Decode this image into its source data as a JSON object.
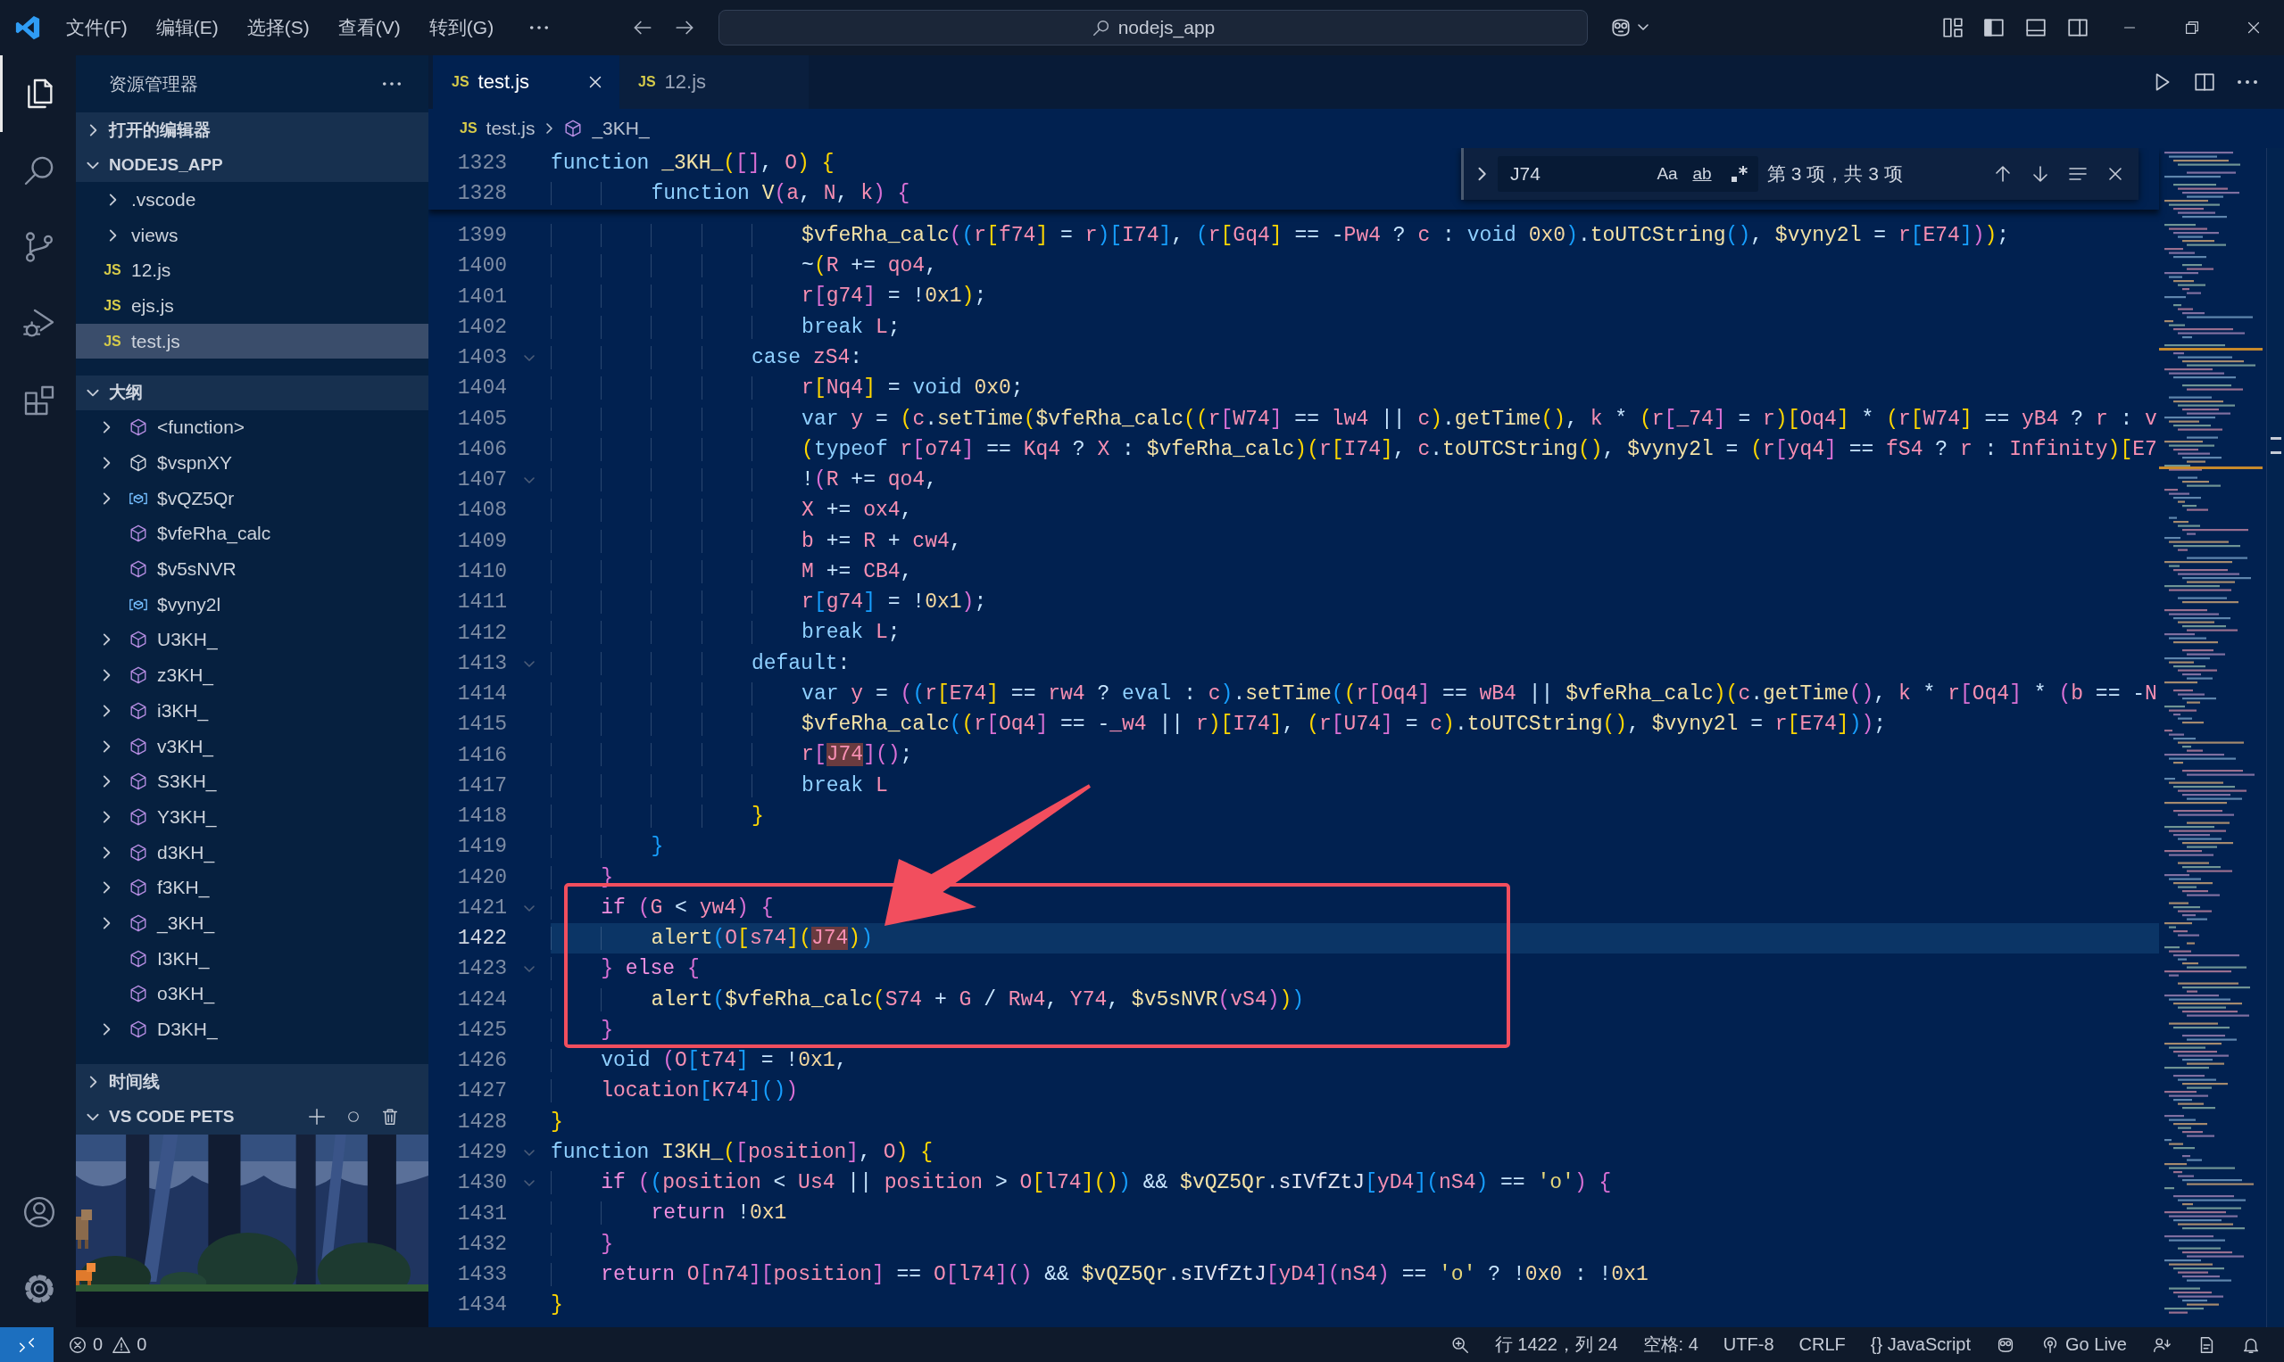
{
  "title_bar": {
    "menus": [
      "文件(F)",
      "编辑(E)",
      "选择(S)",
      "查看(V)",
      "转到(G)"
    ],
    "search": "nodejs_app"
  },
  "activity_bar": {
    "items": [
      {
        "kind": "files",
        "selected": true
      },
      {
        "kind": "search",
        "selected": false
      },
      {
        "kind": "source_control",
        "selected": false
      },
      {
        "kind": "run_debug",
        "selected": false
      },
      {
        "kind": "extensions",
        "selected": false
      }
    ],
    "bottom": [
      {
        "kind": "account"
      },
      {
        "kind": "settings"
      }
    ]
  },
  "sidebar": {
    "title": "资源管理器",
    "open_editors": {
      "label": "打开的编辑器",
      "expanded": false
    },
    "folder": {
      "label": "NODEJS_APP",
      "expanded": true,
      "items": [
        {
          "name": ".vscode",
          "kind": "folder",
          "expanded": false,
          "selected": false
        },
        {
          "name": "views",
          "kind": "folder",
          "expanded": false,
          "selected": false
        },
        {
          "name": "12.js",
          "kind": "file",
          "icon_text": "JS",
          "selected": false
        },
        {
          "name": "ejs.js",
          "kind": "file",
          "icon_text": "JS",
          "selected": false
        },
        {
          "name": "test.js",
          "kind": "file",
          "icon_text": "JS",
          "selected": true
        }
      ]
    },
    "outline": {
      "label": "大纲",
      "expanded": true,
      "items": [
        {
          "name": "<function>",
          "kind": "method",
          "has_children": true
        },
        {
          "name": "$vspnXY",
          "kind": "module",
          "has_children": true
        },
        {
          "name": "$vQZ5Qr",
          "kind": "variable",
          "has_children": true
        },
        {
          "name": "$vfeRha_calc",
          "kind": "method",
          "has_children": false
        },
        {
          "name": "$v5sNVR",
          "kind": "method",
          "has_children": false
        },
        {
          "name": "$vyny2l",
          "kind": "variable",
          "has_children": false
        },
        {
          "name": "U3KH_",
          "kind": "method",
          "has_children": true
        },
        {
          "name": "z3KH_",
          "kind": "method",
          "has_children": true
        },
        {
          "name": "i3KH_",
          "kind": "method",
          "has_children": true
        },
        {
          "name": "v3KH_",
          "kind": "method",
          "has_children": true
        },
        {
          "name": "S3KH_",
          "kind": "method",
          "has_children": true
        },
        {
          "name": "Y3KH_",
          "kind": "method",
          "has_children": true
        },
        {
          "name": "d3KH_",
          "kind": "method",
          "has_children": true
        },
        {
          "name": "f3KH_",
          "kind": "method",
          "has_children": true
        },
        {
          "name": "_3KH_",
          "kind": "method",
          "has_children": true
        },
        {
          "name": "I3KH_",
          "kind": "method",
          "has_children": false
        },
        {
          "name": "o3KH_",
          "kind": "method",
          "has_children": false
        },
        {
          "name": "D3KH_",
          "kind": "method",
          "has_children": true
        }
      ]
    },
    "timeline": {
      "label": "时间线",
      "expanded": false
    },
    "pets": {
      "label": "VS CODE PETS",
      "expanded": true
    }
  },
  "editor": {
    "tabs": [
      {
        "icon_text": "JS",
        "label": "test.js",
        "selected": true
      },
      {
        "icon_text": "JS",
        "label": "12.js",
        "selected": false
      }
    ],
    "breadcrumb": [
      {
        "kind": "file",
        "icon_text": "JS",
        "label": "test.js"
      },
      {
        "kind": "symbol",
        "label": "_3KH_"
      }
    ],
    "find": {
      "replace_expanded": false,
      "value": "J74",
      "options": [
        {
          "kind": "case",
          "label": "Aa",
          "on": false
        },
        {
          "kind": "word",
          "label": "ab",
          "on": false
        },
        {
          "kind": "regex",
          "on": false
        }
      ],
      "result": "第 3 项，共 3 项"
    },
    "sticky": [
      {
        "number": "1323",
        "segments": [
          {
            "kind": "keyword",
            "text": "function"
          },
          {
            "kind": "code",
            "text": " _3KH_([], O) {"
          }
        ]
      },
      {
        "number": "1328",
        "segments": [
          {
            "kind": "keyword",
            "text": "        function"
          },
          {
            "kind": "code",
            "text": " V(a, N, k) {"
          }
        ]
      }
    ],
    "lines": [
      {
        "number": "1399",
        "current": false,
        "foldable": false,
        "segments": [
          {
            "kind": "code",
            "text": "                    $vfeRha_calc((r[f74] = r)[I74], (r[Gq4] == -Pw4 ? c : "
          },
          {
            "kind": "keyword",
            "text": "void"
          },
          {
            "kind": "code",
            "text": " 0x0).toUTCString(), $vyny2l = r[E74]));"
          }
        ]
      },
      {
        "number": "1400",
        "current": false,
        "foldable": false,
        "segments": [
          {
            "kind": "code",
            "text": "                    ~(R += qo4,"
          }
        ]
      },
      {
        "number": "1401",
        "current": false,
        "foldable": false,
        "segments": [
          {
            "kind": "code",
            "text": "                    r[g74] = !0x1);"
          }
        ]
      },
      {
        "number": "1402",
        "current": false,
        "foldable": false,
        "segments": [
          {
            "kind": "keyword",
            "text": "                    break"
          },
          {
            "kind": "code",
            "text": " L;"
          }
        ]
      },
      {
        "number": "1403",
        "current": false,
        "foldable": true,
        "segments": [
          {
            "kind": "keyword",
            "text": "                case"
          },
          {
            "kind": "code",
            "text": " zS4:"
          }
        ]
      },
      {
        "number": "1404",
        "current": false,
        "foldable": false,
        "segments": [
          {
            "kind": "code",
            "text": "                    r[Nq4] = "
          },
          {
            "kind": "keyword",
            "text": "void"
          },
          {
            "kind": "code",
            "text": " 0x0;"
          }
        ]
      },
      {
        "number": "1405",
        "current": false,
        "foldable": false,
        "segments": [
          {
            "kind": "keyword",
            "text": "                    var"
          },
          {
            "kind": "code",
            "text": " y = (c.setTime($vfeRha_calc((r[W74] == lw4 || c).getTime(), k * (r[_74] = r)[Oq4] * (r[W74] == yB4 ? r : v"
          }
        ]
      },
      {
        "number": "1406",
        "current": false,
        "foldable": false,
        "segments": [
          {
            "kind": "code",
            "text": "                    ("
          },
          {
            "kind": "keyword",
            "text": "typeof"
          },
          {
            "kind": "code",
            "text": " r[o74] == Kq4 ? X : $vfeRha_calc)(r[I74], c.toUTCString(), $vyny2l = (r[yq4] == fS4 ? r : Infinity)[E7"
          }
        ]
      },
      {
        "number": "1407",
        "current": false,
        "foldable": true,
        "segments": [
          {
            "kind": "code",
            "text": "                    !(R += qo4,"
          }
        ]
      },
      {
        "number": "1408",
        "current": false,
        "foldable": false,
        "segments": [
          {
            "kind": "code",
            "text": "                    X += ox4,"
          }
        ]
      },
      {
        "number": "1409",
        "current": false,
        "foldable": false,
        "segments": [
          {
            "kind": "code",
            "text": "                    b += R + cw4,"
          }
        ]
      },
      {
        "number": "1410",
        "current": false,
        "foldable": false,
        "segments": [
          {
            "kind": "code",
            "text": "                    M += CB4,"
          }
        ]
      },
      {
        "number": "1411",
        "current": false,
        "foldable": false,
        "segments": [
          {
            "kind": "code",
            "text": "                    r[g74] = !0x1);"
          }
        ]
      },
      {
        "number": "1412",
        "current": false,
        "foldable": false,
        "segments": [
          {
            "kind": "keyword",
            "text": "                    break"
          },
          {
            "kind": "code",
            "text": " L;"
          }
        ]
      },
      {
        "number": "1413",
        "current": false,
        "foldable": true,
        "segments": [
          {
            "kind": "keyword",
            "text": "                default"
          },
          {
            "kind": "code",
            "text": ":"
          }
        ]
      },
      {
        "number": "1414",
        "current": false,
        "foldable": false,
        "segments": [
          {
            "kind": "keyword",
            "text": "                    var"
          },
          {
            "kind": "code",
            "text": " y = ((r[E74] == rw4 ? "
          },
          {
            "kind": "keyword",
            "text": "eval"
          },
          {
            "kind": "code",
            "text": " : c).setTime((r[Oq4] == wB4 || $vfeRha_calc)(c.getTime(), k * r[Oq4] * (b == -N"
          }
        ]
      },
      {
        "number": "1415",
        "current": false,
        "foldable": false,
        "segments": [
          {
            "kind": "code",
            "text": "                    $vfeRha_calc((r[Oq4] == -_w4 || r)[I74], (r[U74] = c).toUTCString(), $vyny2l = r[E74]));"
          }
        ]
      },
      {
        "number": "1416",
        "current": false,
        "foldable": false,
        "segments": [
          {
            "kind": "code",
            "text": "                    r["
          },
          {
            "kind": "match",
            "text": "J74"
          },
          {
            "kind": "code",
            "text": "]();"
          }
        ]
      },
      {
        "number": "1417",
        "current": false,
        "foldable": false,
        "segments": [
          {
            "kind": "keyword",
            "text": "                    break"
          },
          {
            "kind": "code",
            "text": " L"
          }
        ]
      },
      {
        "number": "1418",
        "current": false,
        "foldable": false,
        "segments": [
          {
            "kind": "code",
            "text": "                }"
          }
        ]
      },
      {
        "number": "1419",
        "current": false,
        "foldable": false,
        "segments": [
          {
            "kind": "code",
            "text": "        }"
          }
        ]
      },
      {
        "number": "1420",
        "current": false,
        "foldable": false,
        "segments": [
          {
            "kind": "code",
            "text": "    }"
          }
        ]
      },
      {
        "number": "1421",
        "current": false,
        "foldable": true,
        "segments": [
          {
            "kind": "control",
            "text": "    if"
          },
          {
            "kind": "code",
            "text": " (G < yw4) {"
          }
        ]
      },
      {
        "number": "1422",
        "current": true,
        "foldable": false,
        "segments": [
          {
            "kind": "code",
            "text": "        alert(O[s74]("
          },
          {
            "kind": "match",
            "text": "J74"
          },
          {
            "kind": "code",
            "text": "))"
          }
        ]
      },
      {
        "number": "1423",
        "current": false,
        "foldable": true,
        "segments": [
          {
            "kind": "code",
            "text": "    } "
          },
          {
            "kind": "control",
            "text": "else"
          },
          {
            "kind": "code",
            "text": " {"
          }
        ]
      },
      {
        "number": "1424",
        "current": false,
        "foldable": false,
        "segments": [
          {
            "kind": "code",
            "text": "        alert($vfeRha_calc(S74 + G / Rw4, Y74, $v5sNVR(vS4)))"
          }
        ]
      },
      {
        "number": "1425",
        "current": false,
        "foldable": false,
        "segments": [
          {
            "kind": "code",
            "text": "    }"
          }
        ]
      },
      {
        "number": "1426",
        "current": false,
        "foldable": false,
        "segments": [
          {
            "kind": "keyword",
            "text": "    void"
          },
          {
            "kind": "code",
            "text": " (O[t74] = !0x1,"
          }
        ]
      },
      {
        "number": "1427",
        "current": false,
        "foldable": false,
        "segments": [
          {
            "kind": "code",
            "text": "    location[K74]())"
          }
        ]
      },
      {
        "number": "1428",
        "current": false,
        "foldable": false,
        "segments": [
          {
            "kind": "code",
            "text": "}"
          }
        ]
      },
      {
        "number": "1429",
        "current": false,
        "foldable": true,
        "segments": [
          {
            "kind": "keyword",
            "text": "function"
          },
          {
            "kind": "code",
            "text": " I3KH_([position], O) {"
          }
        ]
      },
      {
        "number": "1430",
        "current": false,
        "foldable": true,
        "segments": [
          {
            "kind": "control",
            "text": "    if"
          },
          {
            "kind": "code",
            "text": " ((position < Us4 || position > O[l74]()) && $vQZ5Qr.sIVfZtJ[yD4](nS4) == 'o') {"
          }
        ]
      },
      {
        "number": "1431",
        "current": false,
        "foldable": false,
        "segments": [
          {
            "kind": "control",
            "text": "        return"
          },
          {
            "kind": "code",
            "text": " !0x1"
          }
        ]
      },
      {
        "number": "1432",
        "current": false,
        "foldable": false,
        "segments": [
          {
            "kind": "code",
            "text": "    }"
          }
        ]
      },
      {
        "number": "1433",
        "current": false,
        "foldable": false,
        "segments": [
          {
            "kind": "control",
            "text": "    return"
          },
          {
            "kind": "code",
            "text": " O[n74][position] == O[l74]() && $vQZ5Qr.sIVfZtJ[yD4](nS4) == 'o' ? !0x0 : !0x1"
          }
        ]
      },
      {
        "number": "1434",
        "current": false,
        "foldable": false,
        "segments": [
          {
            "kind": "code",
            "text": "}"
          }
        ]
      }
    ]
  },
  "status_bar": {
    "problems": [
      {
        "kind": "error",
        "count": "0"
      },
      {
        "kind": "warning",
        "count": "0"
      }
    ],
    "position": "行 1422，列 24",
    "indentation": "空格: 4",
    "encoding": "UTF-8",
    "line_ending": "CRLF",
    "language": "{} JavaScript",
    "live_server": "Go Live"
  }
}
